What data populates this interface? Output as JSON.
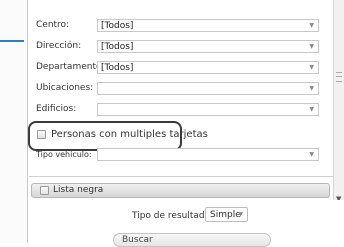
{
  "filters": [
    {
      "label": "Centro:",
      "value": "[Todos]"
    },
    {
      "label": "Dirección:",
      "value": "[Todos]"
    },
    {
      "label": "Departamento:",
      "value": "[Todos]"
    },
    {
      "label": "Ubicaciones:",
      "value": ""
    },
    {
      "label": "Edificios:",
      "value": ""
    }
  ],
  "multi_card": {
    "label": "Personas con multiples tarjetas",
    "checked": false
  },
  "vehicle": {
    "label": "Tipo vehiculo:",
    "value": ""
  },
  "lista_negra": {
    "label": "Lista negra",
    "checked": false
  },
  "result_type": {
    "label": "Tipo de resultado:",
    "value": "Simple"
  },
  "search_button": {
    "label": "Buscar"
  }
}
